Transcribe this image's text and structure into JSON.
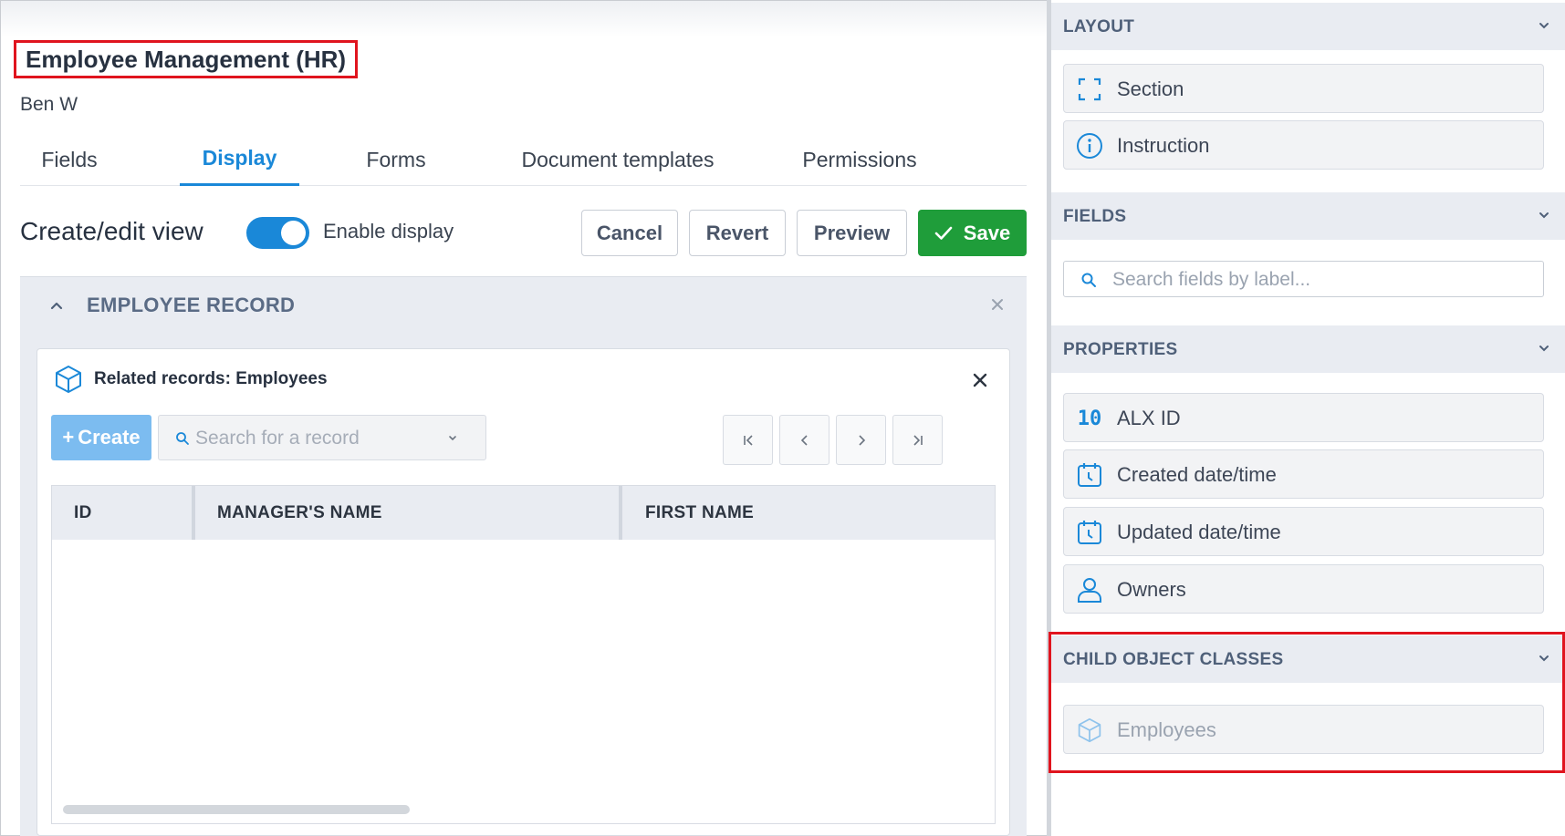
{
  "header": {
    "app_title": "Employee Management (HR)",
    "owner": "Ben W"
  },
  "tabs": [
    {
      "label": "Fields",
      "active": false
    },
    {
      "label": "Display",
      "active": true
    },
    {
      "label": "Forms",
      "active": false
    },
    {
      "label": "Document templates",
      "active": false
    },
    {
      "label": "Permissions",
      "active": false
    }
  ],
  "view": {
    "title": "Create/edit view",
    "toggle_on": true,
    "toggle_label": "Enable display"
  },
  "toolbar": {
    "cancel": "Cancel",
    "revert": "Revert",
    "preview": "Preview",
    "save": "Save"
  },
  "section": {
    "title": "EMPLOYEE RECORD"
  },
  "related": {
    "title": "Related records: Employees",
    "create_label": "Create",
    "search_placeholder": "Search for a record",
    "columns": [
      "ID",
      "MANAGER'S NAME",
      "FIRST NAME"
    ]
  },
  "panel": {
    "layout": {
      "header": "LAYOUT",
      "items": [
        {
          "label": "Section",
          "icon": "section-icon"
        },
        {
          "label": "Instruction",
          "icon": "info-icon"
        }
      ]
    },
    "fields": {
      "header": "FIELDS",
      "search_placeholder": "Search fields by label..."
    },
    "properties": {
      "header": "PROPERTIES",
      "items": [
        {
          "label": "ALX ID",
          "icon": "id-icon",
          "icon_text": "10"
        },
        {
          "label": "Created date/time",
          "icon": "calendar-clock-icon"
        },
        {
          "label": "Updated date/time",
          "icon": "calendar-clock-icon"
        },
        {
          "label": "Owners",
          "icon": "user-icon"
        }
      ]
    },
    "child_object_classes": {
      "header": "CHILD OBJECT CLASSES",
      "items": [
        {
          "label": "Employees",
          "icon": "cube-icon",
          "disabled": true
        }
      ]
    }
  },
  "colors": {
    "accent": "#1a88d8",
    "save": "#1f9d3a",
    "highlight": "#e0141e"
  }
}
